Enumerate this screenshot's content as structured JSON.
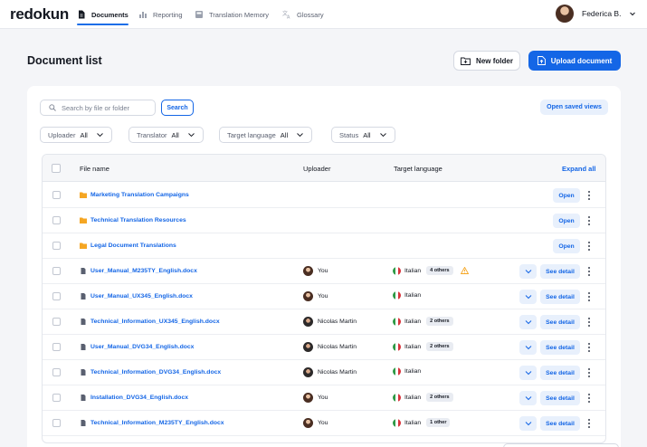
{
  "brand": {
    "logo": "redokun"
  },
  "nav": [
    {
      "label": "Documents",
      "icon": "document-icon",
      "active": true
    },
    {
      "label": "Reporting",
      "icon": "bar-chart-icon",
      "active": false
    },
    {
      "label": "Translation Memory",
      "icon": "database-icon",
      "active": false
    },
    {
      "label": "Glossary",
      "icon": "translate-icon",
      "active": false
    }
  ],
  "user": {
    "name": "Federica B."
  },
  "page": {
    "title": "Document list"
  },
  "actions": {
    "new_folder": "New folder",
    "upload": "Upload document"
  },
  "search": {
    "placeholder": "Search by file or folder",
    "button": "Search",
    "saved_views": "Open saved views"
  },
  "filters": [
    {
      "label": "Uploader",
      "value": "All"
    },
    {
      "label": "Translator",
      "value": "All"
    },
    {
      "label": "Target language",
      "value": "All"
    },
    {
      "label": "Status",
      "value": "All"
    }
  ],
  "table": {
    "columns": {
      "file_name": "File name",
      "uploader": "Uploader",
      "target_language": "Target language",
      "expand_all": "Expand all"
    },
    "open_label": "Open",
    "detail_label": "See detail",
    "rows": [
      {
        "type": "folder",
        "name": "Marketing Translation Campaigns"
      },
      {
        "type": "folder",
        "name": "Technical Translation Resources"
      },
      {
        "type": "folder",
        "name": "Legal Document Translations"
      },
      {
        "type": "file",
        "name": "User_Manual_M235TY_English.docx",
        "uploader": "You",
        "language": "Italian",
        "others": "4 others",
        "warning": true
      },
      {
        "type": "file",
        "name": "User_Manual_UX345_English.docx",
        "uploader": "You",
        "language": "Italian",
        "others": ""
      },
      {
        "type": "file",
        "name": "Technical_Information_UX345_English.docx",
        "uploader": "Nicolas Martin",
        "language": "Italian",
        "others": "2 others"
      },
      {
        "type": "file",
        "name": "User_Manual_DVG34_English.docx",
        "uploader": "Nicolas Martin",
        "language": "Italian",
        "others": "2 others"
      },
      {
        "type": "file",
        "name": "Technical_Information_DVG34_English.docx",
        "uploader": "Nicolas Martin",
        "language": "Italian",
        "others": ""
      },
      {
        "type": "file",
        "name": "Installation_DVG34_English.docx",
        "uploader": "You",
        "language": "Italian",
        "others": "2 others"
      },
      {
        "type": "file",
        "name": "Technical_Information_M235TY_English.docx",
        "uploader": "You",
        "language": "Italian",
        "others": "1 other"
      }
    ]
  },
  "colors": {
    "accent": "#1466e6",
    "folder": "#f5a623",
    "warning": "#f5a623"
  }
}
